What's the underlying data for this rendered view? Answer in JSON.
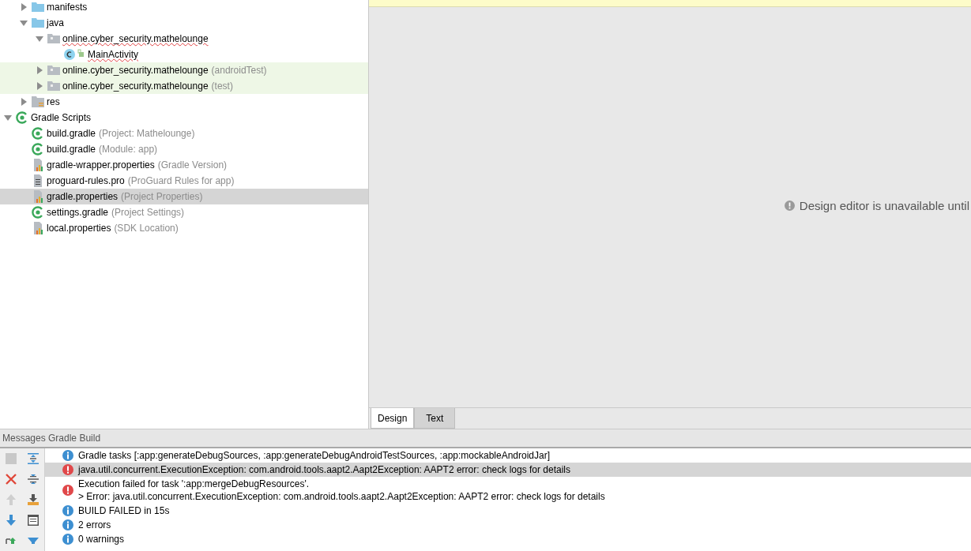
{
  "project_tree": {
    "scrolled_parent_children": [
      {
        "label": "manifests",
        "kind": "folder",
        "expanded": false,
        "selected": false,
        "test": false,
        "misspelled": false
      },
      {
        "label": "java",
        "kind": "folder",
        "expanded": true,
        "selected": false,
        "test": false,
        "misspelled": false,
        "children": [
          {
            "label": "online.cyber_security.mathelounge",
            "kind": "package",
            "expanded": true,
            "selected": false,
            "test": false,
            "misspelled": true,
            "children": [
              {
                "label": "MainActivity",
                "kind": "class",
                "selected": false,
                "test": false,
                "misspelled": true
              }
            ]
          },
          {
            "label": "online.cyber_security.mathelounge",
            "hint": "(androidTest)",
            "kind": "package",
            "expanded": false,
            "selected": false,
            "test": true,
            "misspelled": false
          },
          {
            "label": "online.cyber_security.mathelounge",
            "hint": "(test)",
            "kind": "package",
            "expanded": false,
            "selected": false,
            "test": true,
            "misspelled": false
          }
        ]
      },
      {
        "label": "res",
        "kind": "res",
        "expanded": false,
        "selected": false,
        "test": false,
        "misspelled": false
      }
    ],
    "items": [
      {
        "label": "Gradle Scripts",
        "kind": "gradle",
        "expanded": true,
        "selected": false,
        "test": false,
        "misspelled": false,
        "children": [
          {
            "label": "build.gradle",
            "hint": "(Project: Mathelounge)",
            "kind": "gradle",
            "selected": false,
            "test": false,
            "misspelled": false
          },
          {
            "label": "build.gradle",
            "hint": "(Module: app)",
            "kind": "gradle",
            "selected": false,
            "test": false,
            "misspelled": false
          },
          {
            "label": "gradle-wrapper.properties",
            "hint": "(Gradle Version)",
            "kind": "properties",
            "selected": false,
            "test": false,
            "misspelled": false
          },
          {
            "label": "proguard-rules.pro",
            "hint": "(ProGuard Rules for app)",
            "kind": "text",
            "selected": false,
            "test": false,
            "misspelled": false
          },
          {
            "label": "gradle.properties",
            "hint": "(Project Properties)",
            "kind": "properties",
            "selected": true,
            "test": false,
            "misspelled": false
          },
          {
            "label": "settings.gradle",
            "hint": "(Project Settings)",
            "kind": "gradle",
            "selected": false,
            "test": false,
            "misspelled": false
          },
          {
            "label": "local.properties",
            "hint": "(SDK Location)",
            "kind": "properties",
            "selected": false,
            "test": false,
            "misspelled": false
          }
        ]
      }
    ]
  },
  "editor": {
    "message": "Design editor is unavailable until",
    "tabs": [
      {
        "label": "Design",
        "selected": true
      },
      {
        "label": "Text",
        "selected": false
      }
    ]
  },
  "messages_panel": {
    "title": "Messages Gradle Build",
    "messages": [
      {
        "kind": "info",
        "selected": false,
        "lines": [
          "Gradle tasks [:app:generateDebugSources, :app:generateDebugAndroidTestSources, :app:mockableAndroidJar]"
        ]
      },
      {
        "kind": "error",
        "selected": true,
        "lines": [
          "java.util.concurrent.ExecutionException: com.android.tools.aapt2.Aapt2Exception: AAPT2 error: check logs for details"
        ]
      },
      {
        "kind": "error",
        "selected": false,
        "lines": [
          "Execution failed for task ':app:mergeDebugResources'.",
          "> Error: java.util.concurrent.ExecutionException: com.android.tools.aapt2.Aapt2Exception: AAPT2 error: check logs for details"
        ]
      },
      {
        "kind": "info",
        "selected": false,
        "lines": [
          "BUILD FAILED in 15s"
        ]
      },
      {
        "kind": "info",
        "selected": false,
        "lines": [
          "2 errors"
        ]
      },
      {
        "kind": "info",
        "selected": false,
        "lines": [
          "0 warnings"
        ]
      }
    ]
  }
}
